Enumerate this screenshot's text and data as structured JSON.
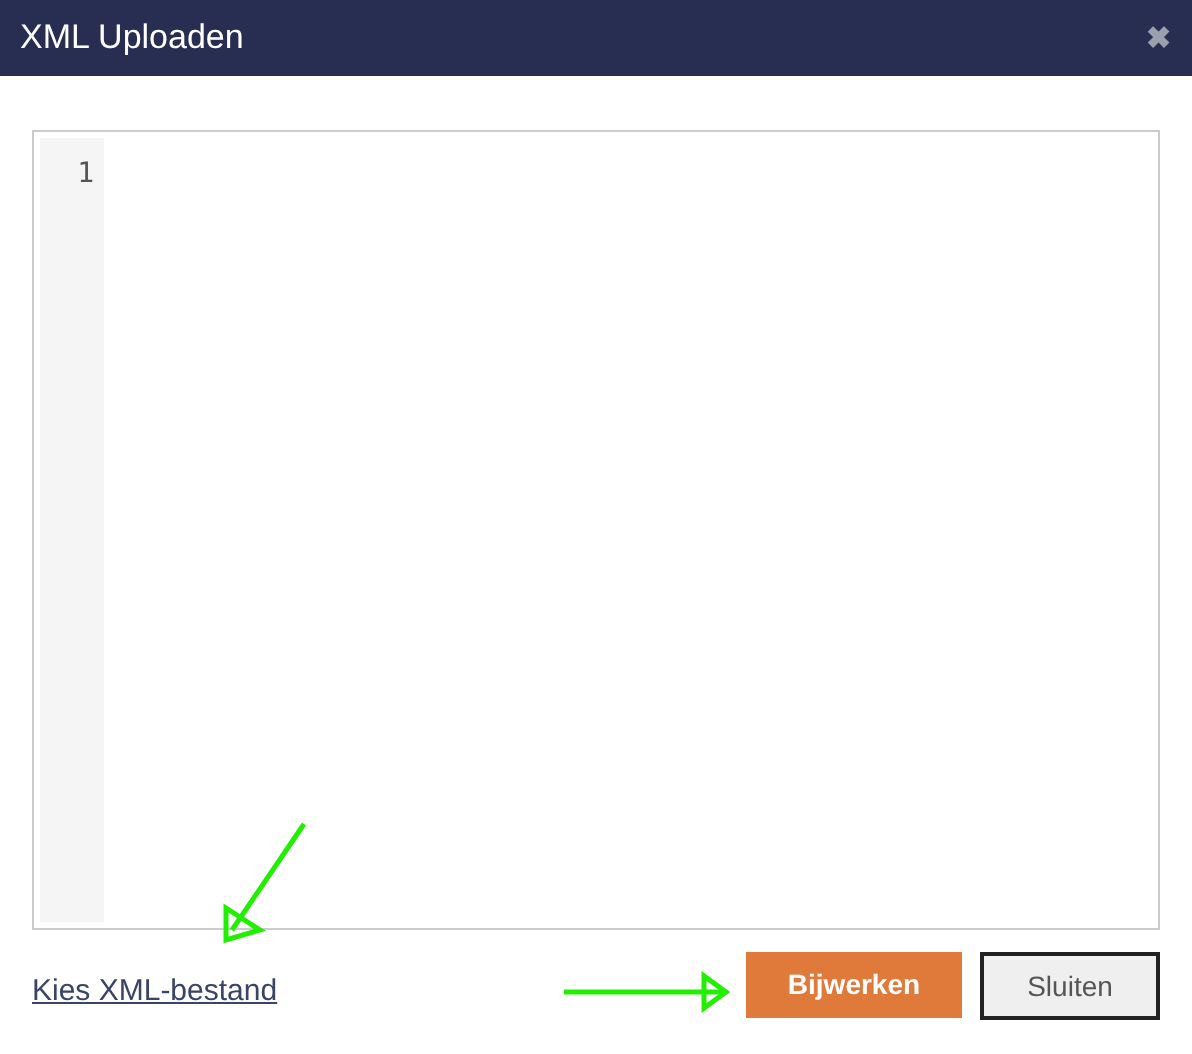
{
  "window": {
    "title": "XML Uploaden",
    "close": "✖"
  },
  "editor": {
    "line_numbers": [
      "1"
    ]
  },
  "footer": {
    "link": "Kies XML-bestand",
    "buttons": [
      {
        "label": "Bijwerken",
        "kind": "primary"
      },
      {
        "label": "Sluiten",
        "kind": "secondary"
      }
    ]
  }
}
